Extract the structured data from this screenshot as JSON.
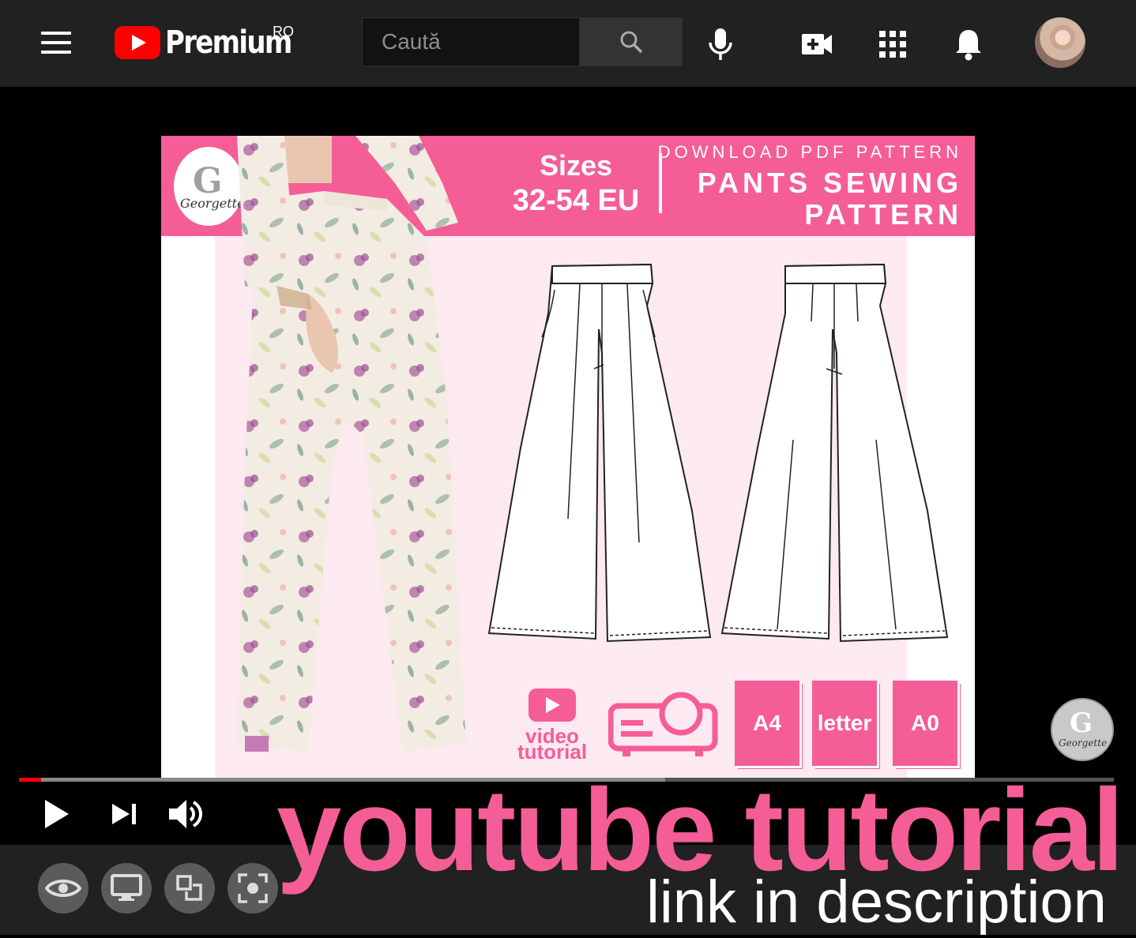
{
  "header": {
    "brand": "Premium",
    "region": "RO",
    "search_placeholder": "Caută",
    "icons": [
      "menu-icon",
      "youtube-logo-icon",
      "search-icon",
      "microphone-icon",
      "create-video-icon",
      "apps-grid-icon",
      "notifications-bell-icon",
      "account-avatar"
    ]
  },
  "thumbnail": {
    "brand_initial": "G",
    "brand_script": "Georgette",
    "sizes_label": "Sizes",
    "sizes_range": "32-54 EU",
    "download_label": "DOWNLOAD PDF PATTERN",
    "title_line1": "PANTS SEWING",
    "title_line2": "PATTERN",
    "video_label_1": "video",
    "video_label_2": "tutorial",
    "formats": [
      "A4",
      "letter",
      "A0"
    ],
    "accent_color": "#f55d97"
  },
  "watermark": {
    "initial": "G",
    "script": "Georgette"
  },
  "player": {
    "progress_played": 0.02,
    "progress_loaded": 0.59,
    "controls": [
      "play-icon",
      "next-icon",
      "volume-icon"
    ],
    "bottom_buttons": [
      "eye-icon",
      "display-icon",
      "pip-icon",
      "screenshot-icon"
    ]
  },
  "overlay": {
    "headline": "youtube tutorial",
    "subline": "link in description"
  }
}
